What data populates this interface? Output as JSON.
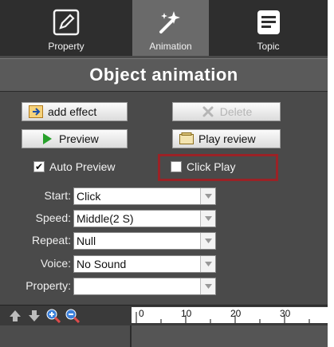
{
  "tabs": [
    {
      "label": "Property",
      "icon": "pencil-icon"
    },
    {
      "label": "Animation",
      "icon": "magic-wand-icon"
    },
    {
      "label": "Topic",
      "icon": "document-icon"
    }
  ],
  "panel_title": "Object animation",
  "buttons": {
    "add_effect": "add effect",
    "delete": "Delete",
    "preview": "Preview",
    "play_review": "Play review"
  },
  "checkboxes": {
    "auto_preview": {
      "label": "Auto Preview",
      "checked": true
    },
    "click_play": {
      "label": "Click Play",
      "checked": false
    }
  },
  "properties": [
    {
      "label": "Start:",
      "value": "Click"
    },
    {
      "label": "Speed:",
      "value": "Middle(2 S)"
    },
    {
      "label": "Repeat:",
      "value": "Null"
    },
    {
      "label": "Voice:",
      "value": "No Sound"
    },
    {
      "label": "Property:",
      "value": ""
    }
  ],
  "timeline": {
    "ruler_labels": [
      "0",
      "10",
      "20",
      "30"
    ]
  },
  "colors": {
    "highlight": "#9b2226",
    "panel_bg": "#4a4a4a"
  }
}
